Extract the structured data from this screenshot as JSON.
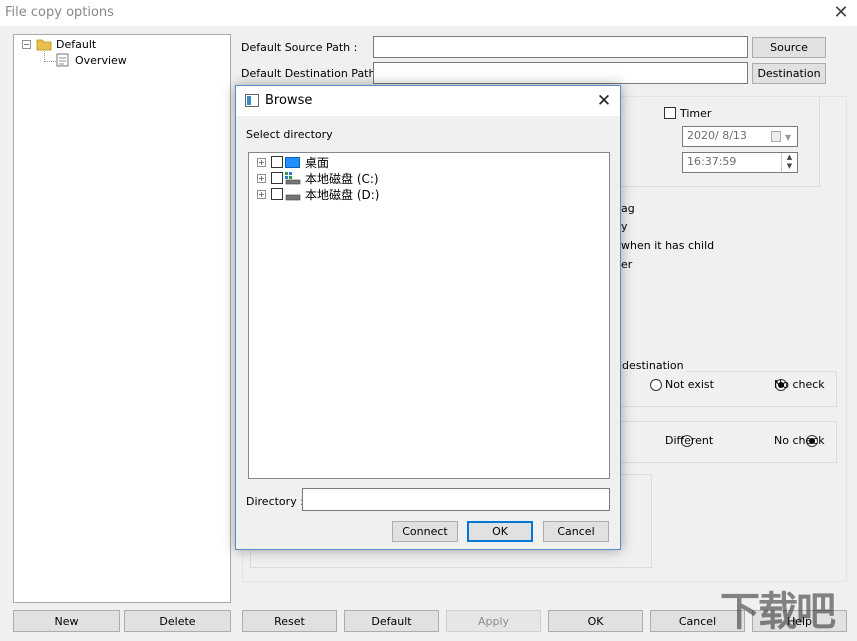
{
  "window": {
    "title": "File copy options"
  },
  "left_tree": {
    "root": "Default",
    "child": "Overview"
  },
  "left_buttons": {
    "new": "New",
    "delete": "Delete"
  },
  "paths": {
    "source_label": "Default Source Path :",
    "source_value": "",
    "source_button": "Source",
    "dest_label": "Default Destination Path :",
    "dest_value": "",
    "dest_button": "Destination"
  },
  "timer": {
    "label": "Timer",
    "date": "2020/  8/13",
    "time": "16:37:59"
  },
  "partial_options": [
    "ag",
    "y",
    "when it has child",
    "er"
  ],
  "groups": {
    "destination_legend": "destination",
    "row1": {
      "opt_a": "Not exist",
      "opt_b": "No check",
      "selected": "No check"
    },
    "row2": {
      "opt_a": "Different",
      "opt_b": "No check",
      "selected": "No check"
    }
  },
  "bottom_buttons": {
    "reset": "Reset",
    "default": "Default",
    "apply": "Apply",
    "ok": "OK",
    "cancel": "Cancel",
    "help": "Help"
  },
  "browse_dialog": {
    "title": "Browse",
    "select_label": "Select directory",
    "items": [
      {
        "label": "桌面",
        "icon": "desktop-icon"
      },
      {
        "label": "本地磁盘 (C:)",
        "icon": "drive-icon"
      },
      {
        "label": "本地磁盘 (D:)",
        "icon": "drive-icon"
      }
    ],
    "directory_label": "Directory :",
    "directory_value": "",
    "connect": "Connect",
    "ok": "OK",
    "cancel": "Cancel"
  },
  "watermark": "下载吧"
}
